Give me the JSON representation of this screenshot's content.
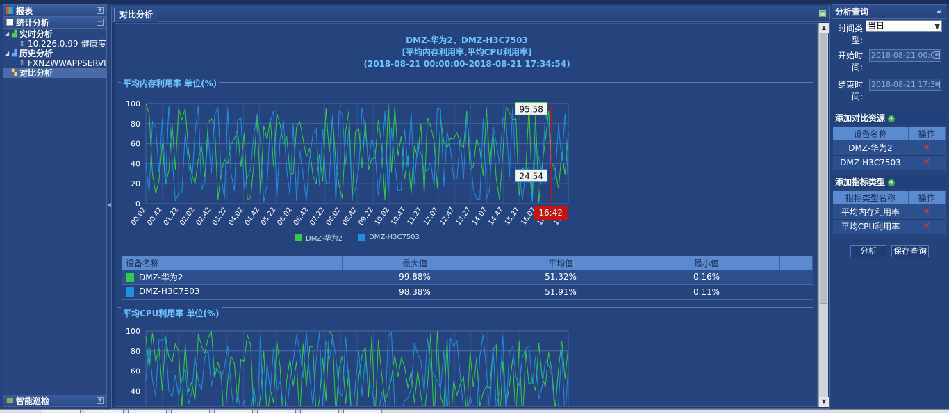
{
  "left_panel": {
    "reports": "报表",
    "stats_analysis": "统计分析",
    "tree": [
      {
        "label": "实时分析",
        "level": 1,
        "bold": true
      },
      {
        "label": "10.226.0.99-健康度",
        "level": 2,
        "bold": false
      },
      {
        "label": "历史分析",
        "level": 1,
        "bold": true
      },
      {
        "label": "FXNZWWAPPSERVI",
        "level": 2,
        "bold": false
      },
      {
        "label": "对比分析",
        "level": 1,
        "bold": true
      }
    ],
    "smart_patrol": "智能巡检"
  },
  "main": {
    "tab_label": "对比分析",
    "chart_title_lines": [
      "DMZ-华为2、DMZ-H3C7503",
      "[平均内存利用率,平均CPU利用率]",
      "(2018-08-21 00:00:00-2018-08-21 17:34:54)"
    ],
    "section1_title": "平均内存利用率 单位(%)",
    "section2_title": "平均CPU利用率 单位(%)",
    "tooltip_green": "95.58",
    "tooltip_blue": "24.54",
    "crosshair_time": "16:42",
    "legend": [
      "DMZ-华为2",
      "DMZ-H3C7503"
    ],
    "stats_headers": [
      "设备名称",
      "最大值",
      "平均值",
      "最小值"
    ],
    "stats_rows": [
      {
        "name": "DMZ-华为2",
        "max": "99.88%",
        "avg": "51.32%",
        "min": "0.16%",
        "color": "#33cc44"
      },
      {
        "name": "DMZ-H3C7503",
        "max": "98.38%",
        "avg": "51.91%",
        "min": "0.11%",
        "color": "#1f8fe0"
      }
    ]
  },
  "colors": {
    "series_green": "#33cc44",
    "series_blue": "#1f8fe0",
    "title_blue": "#6fc3ff",
    "alert_red": "#cc1111"
  },
  "chart_data": [
    {
      "type": "line",
      "title": "平均内存利用率 单位(%)",
      "ylim": [
        0,
        100
      ],
      "yticks": [
        0,
        20,
        40,
        60,
        80,
        100
      ],
      "x": [
        "00:02",
        "00:42",
        "01:22",
        "02:02",
        "02:42",
        "03:22",
        "04:02",
        "04:42",
        "05:22",
        "06:02",
        "06:42",
        "07:22",
        "08:02",
        "08:42",
        "09:22",
        "10:02",
        "10:47",
        "11:27",
        "12:07",
        "12:47",
        "13:27",
        "14:07",
        "14:47",
        "15:27",
        "16:07",
        "16:47",
        "17:27"
      ],
      "series": [
        {
          "name": "DMZ-华为2",
          "color": "#33cc44",
          "values": [
            100,
            60,
            95,
            20,
            85,
            40,
            70,
            10,
            90,
            30,
            55,
            95,
            5,
            75,
            45,
            100,
            25,
            80,
            15,
            65,
            35,
            95,
            50,
            8,
            88,
            40,
            70
          ]
        },
        {
          "name": "DMZ-H3C7503",
          "color": "#1f8fe0",
          "values": [
            40,
            85,
            10,
            70,
            30,
            95,
            15,
            60,
            5,
            80,
            45,
            20,
            90,
            35,
            65,
            10,
            75,
            50,
            95,
            25,
            55,
            5,
            85,
            30,
            60,
            24,
            15
          ]
        }
      ],
      "grid": true,
      "legend_position": "bottom"
    },
    {
      "type": "line",
      "title": "平均CPU利用率 单位(%)",
      "ylim": [
        0,
        100
      ],
      "yticks": [
        40,
        60,
        80,
        100
      ],
      "series": [
        {
          "name": "DMZ-华为2",
          "color": "#33cc44",
          "values": [
            95,
            40,
            80,
            30,
            100,
            50,
            70,
            35,
            90,
            45,
            85,
            30,
            75,
            55,
            95,
            40,
            65,
            35,
            100,
            50,
            80,
            45,
            70,
            90,
            40,
            60,
            85
          ]
        },
        {
          "name": "DMZ-H3C7503",
          "color": "#1f8fe0",
          "values": [
            50,
            90,
            35,
            75,
            45,
            85,
            30,
            95,
            40,
            70,
            55,
            90,
            35,
            80,
            45,
            95,
            30,
            70,
            50,
            85,
            35,
            60,
            95,
            45,
            75,
            55,
            65
          ]
        }
      ],
      "grid": true
    }
  ],
  "right_panel": {
    "title": "分析查询",
    "collapse_glyph": "«",
    "time_type_label": "时间类型:",
    "time_type_value": "当日",
    "start_label": "开始时间:",
    "start_value": "2018-08-21 00:0",
    "end_label": "结束时间:",
    "end_value": "2018-08-21 17:3",
    "add_resource": "添加对比资源",
    "res_headers": [
      "设备名称",
      "操作"
    ],
    "resources": [
      "DMZ-华为2",
      "DMZ-H3C7503"
    ],
    "add_metric": "添加指标类型",
    "metric_headers": [
      "指标类型名称",
      "操作"
    ],
    "metrics": [
      "平均内存利用率",
      "平均CPU利用率"
    ],
    "analyze_btn": "分析",
    "save_btn": "保存查询"
  }
}
